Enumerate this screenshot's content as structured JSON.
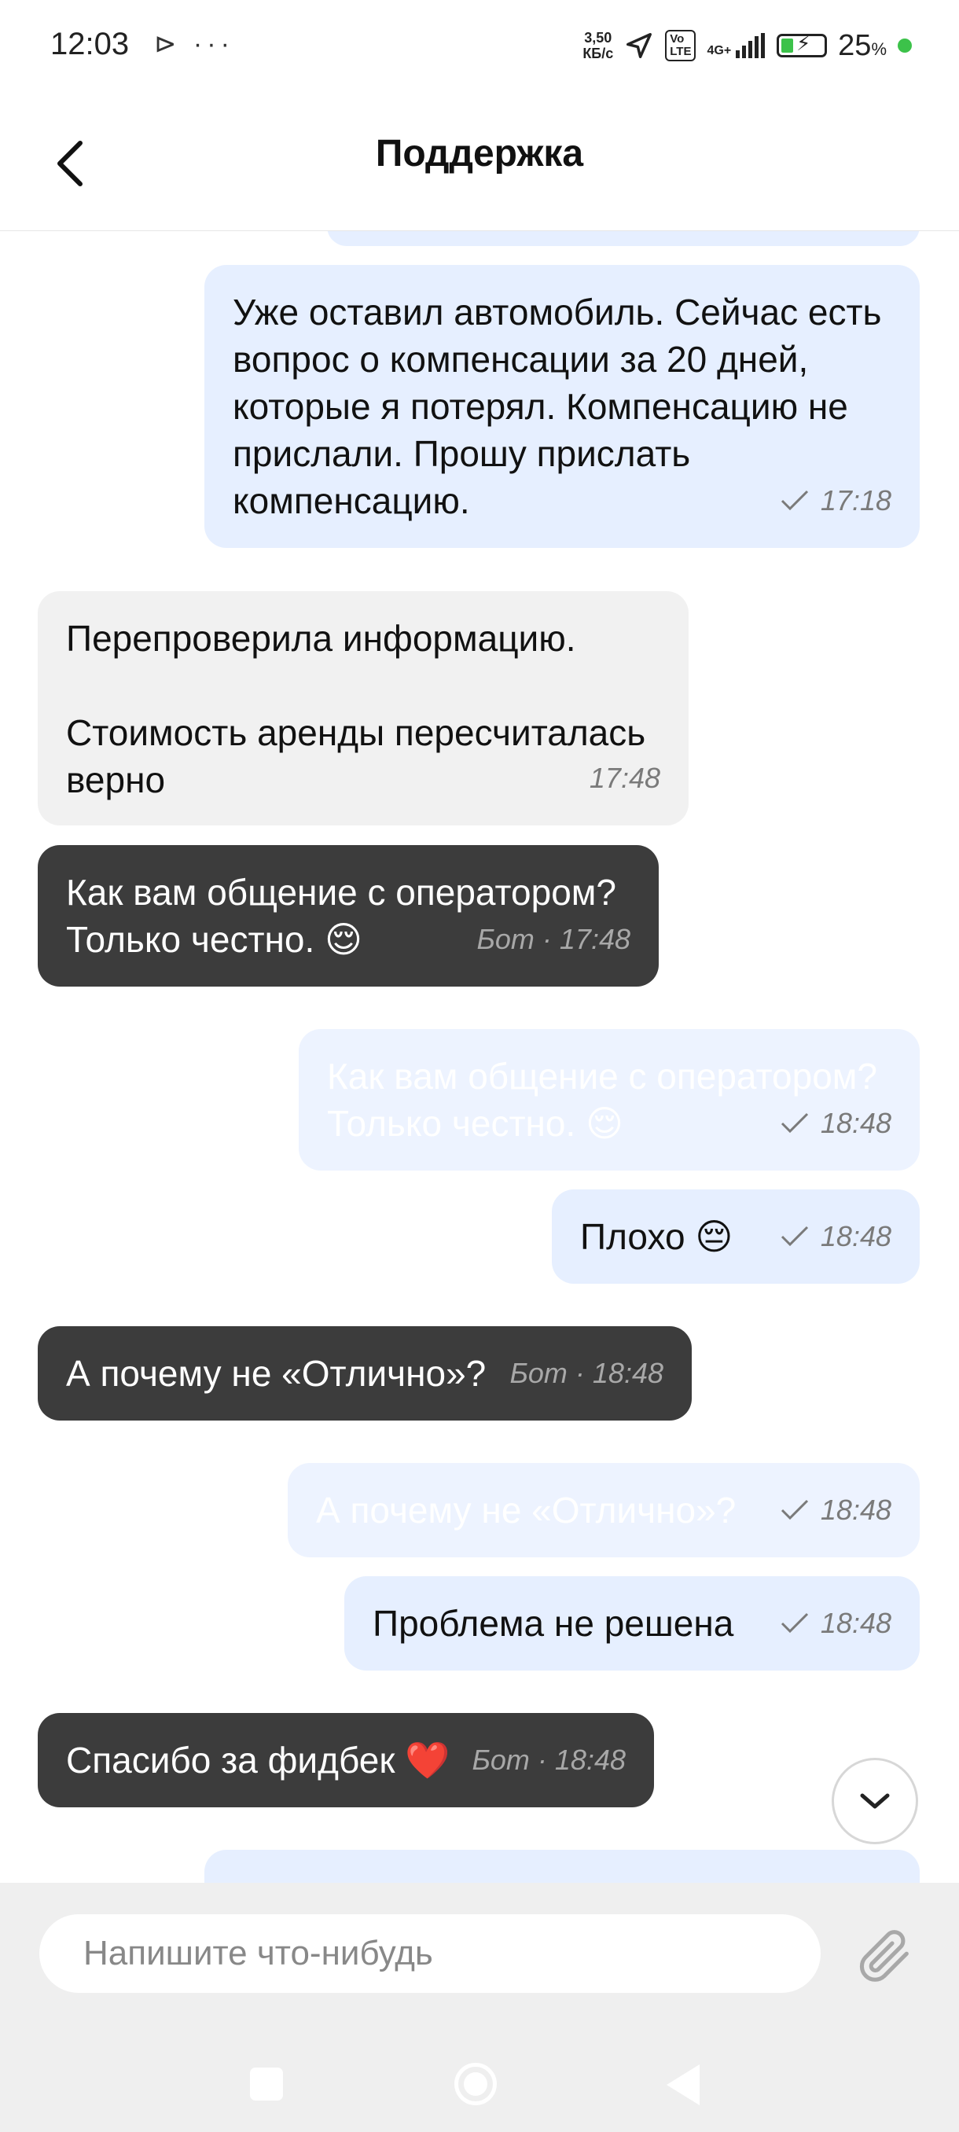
{
  "status_bar": {
    "time": "12:03",
    "left_icons": "⊳ ···",
    "speed": "3,50\nКБ/с",
    "volte": "Vo\nLTE",
    "network": "4G+",
    "battery_percent": "25",
    "battery_suffix": "%"
  },
  "header": {
    "title": "Поддержка",
    "back_icon": "chevron-left-icon"
  },
  "messages": [
    {
      "type": "out",
      "text": "Уже оставил автомобиль. Сейчас есть\nвопрос о компенсации за 20 дней,\nкоторые я потерял. Компенсацию не\nприслали. Прошу прислать\nкомпенсацию.",
      "time": "17:18"
    },
    {
      "type": "in",
      "text": "Перепроверила информацию.\n\nСтоимость аренды пересчиталась\nверно",
      "time": "17:48"
    },
    {
      "type": "bot",
      "text": "Как вам общение с оператором?\nТолько честно. 😌",
      "time": "Бот · 17:48"
    },
    {
      "type": "ghost",
      "text": "Как вам общение с оператором?\nТолько честно. 😌",
      "time": "18:48"
    },
    {
      "type": "out",
      "text": "Плохо 😔",
      "time": "18:48"
    },
    {
      "type": "bot",
      "text": "А почему не «Отлично»?",
      "time": "Бот · 18:48"
    },
    {
      "type": "ghost",
      "text": "А почему не «Отлично»?",
      "time": "18:48"
    },
    {
      "type": "out",
      "text": "Проблема не решена",
      "time": "18:48"
    },
    {
      "type": "bot",
      "text": "Спасибо за фидбек ❤️",
      "time": "Бот · 18:48"
    }
  ],
  "composer": {
    "placeholder": "Напишите что-нибудь",
    "attach_icon": "paperclip-icon"
  },
  "scroll_down_icon": "chevron-down-icon",
  "colors": {
    "outgoing_bubble": "#e6efff",
    "incoming_bubble": "#f1f1f1",
    "bot_bubble": "#3c3c3c",
    "composer_bg": "#efefef"
  }
}
